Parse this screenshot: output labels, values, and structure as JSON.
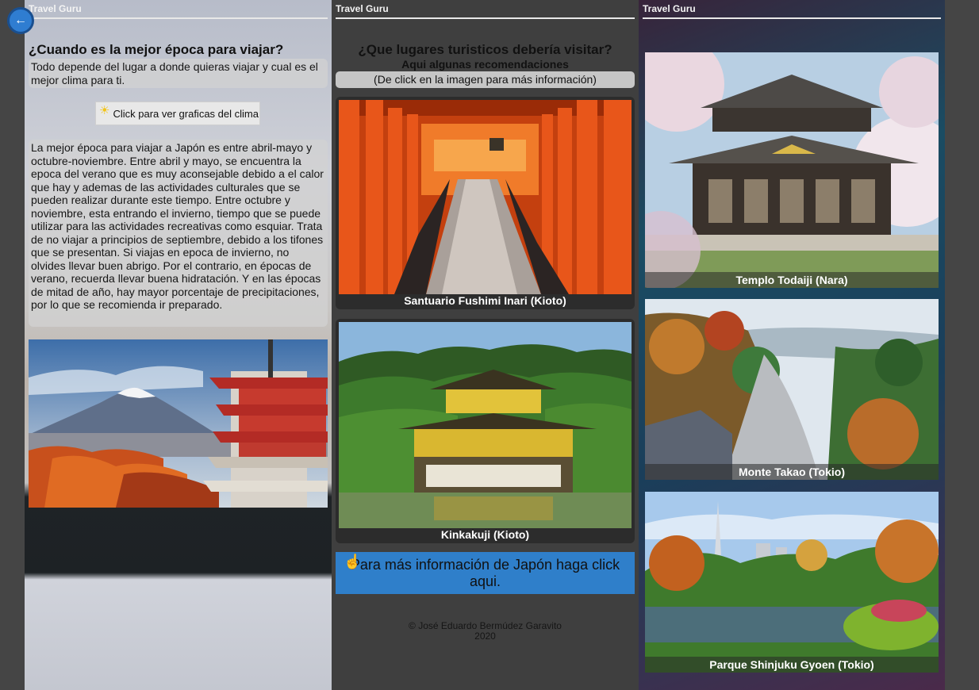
{
  "brand": "Travel Guru",
  "nav": {
    "back_icon": "←"
  },
  "left": {
    "heading": "¿Cuando es la mejor época para viajar?",
    "intro": "Todo depende del lugar a donde quieras viajar y cual es el mejor clima para ti.",
    "weather_button": "Click para ver graficas del clima",
    "body": "La mejor época para viajar a Japón es entre abril-mayo y octubre-noviembre. Entre abril y mayo, se encuentra la epoca del verano que es muy aconsejable debido a el calor que hay y ademas de las actividades culturales que se pueden realizar durante este tiempo. Entre octubre y noviembre, esta entrando el invierno, tiempo que se puede utilizar para las actividades recreativas como esquiar. Trata de no viajar a principios de septiembre, debido a los tifones que se presentan. Si viajas en epoca de invierno, no olvides llevar buen abrigo. Por el contrario, en épocas de verano, recuerda llevar buena hidratación. Y en las épocas de mitad de año, hay mayor porcentaje de precipitaciones, por lo que se recomienda ir preparado."
  },
  "middle": {
    "heading": "¿Que lugares turisticos debería visitar?",
    "subheading": "Aqui algunas recomendaciones",
    "hint": "(De click en la imagen para más información)",
    "cards": [
      {
        "caption": "Santuario Fushimi Inari (Kioto)"
      },
      {
        "caption": "Kinkakuji (Kioto)"
      }
    ],
    "info_link": "Para más información de Japón haga click aqui.",
    "credit_name": "© José Eduardo Bermúdez Garavito",
    "credit_year": "2020"
  },
  "right": {
    "cards": [
      {
        "caption": "Templo Todaiji (Nara)"
      },
      {
        "caption": "Monte Takao (Tokio)"
      },
      {
        "caption": "Parque Shinjuku Gyoen (Tokio)"
      }
    ]
  }
}
